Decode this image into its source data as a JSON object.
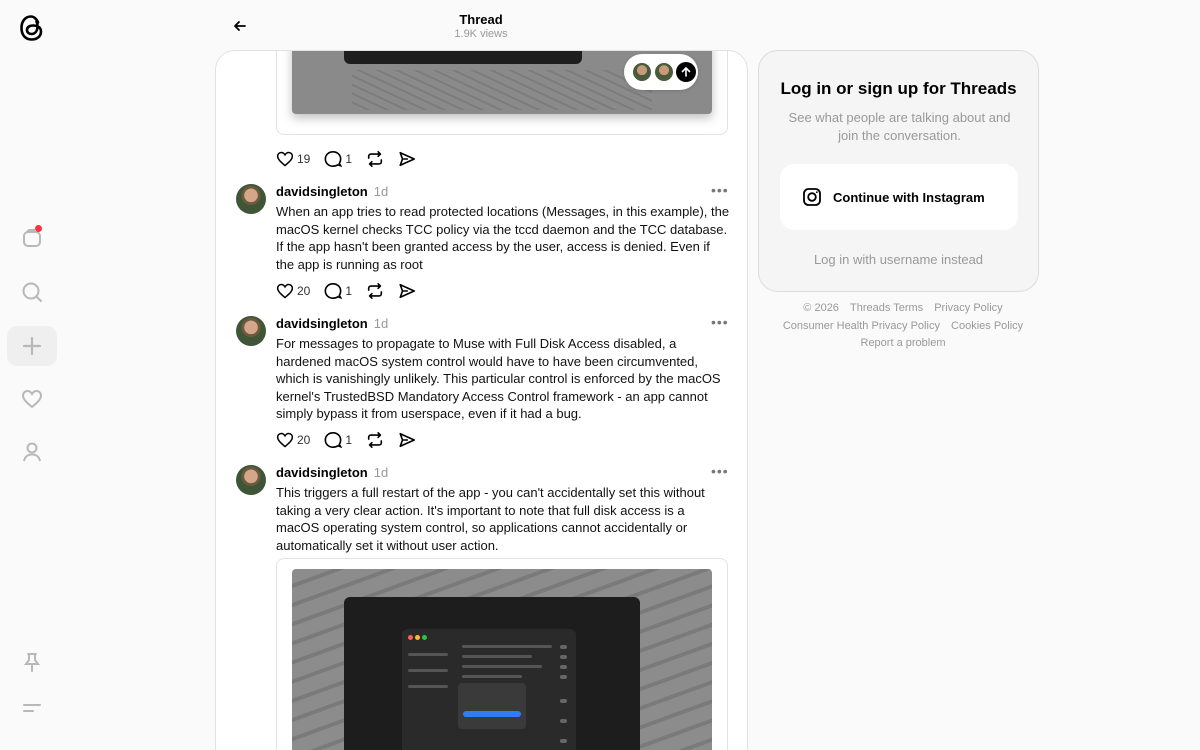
{
  "nav": {
    "logo": "threads-logo-icon",
    "items": [
      "activity-icon",
      "search-icon",
      "create-icon",
      "heart-icon",
      "profile-icon"
    ],
    "bottom": [
      "pin-icon",
      "menu-icon"
    ]
  },
  "header": {
    "title": "Thread",
    "views": "1.9K views"
  },
  "posts": [
    {
      "likes": "19",
      "replies": "1"
    },
    {
      "user": "davidsingleton",
      "time": "1d",
      "text": "When an app tries to read protected locations (Messages, in this example), the macOS kernel checks TCC policy via the tccd daemon and the TCC database. If the app hasn't been granted access by the user, access is denied. Even if the app is running as root",
      "likes": "20",
      "replies": "1"
    },
    {
      "user": "davidsingleton",
      "time": "1d",
      "text": "For messages to propagate to Muse with Full Disk Access disabled, a hardened macOS system control would have to have been circumvented, which is vanishingly unlikely. This particular control is enforced by the macOS kernel's TrustedBSD Mandatory Access Control framework - an app cannot simply bypass it from userspace, even if it had a bug.",
      "likes": "20",
      "replies": "1"
    },
    {
      "user": "davidsingleton",
      "time": "1d",
      "text": "This triggers a full restart of the app - you can't accidentally set this without taking a very clear action. It's important to note that full disk access is a macOS operating system control, so applications cannot accidentally or automatically set it without user action."
    }
  ],
  "login": {
    "title": "Log in or sign up for Threads",
    "subtitle": "See what people are talking about and join the conversation.",
    "instagram_button": "Continue with Instagram",
    "alt_login": "Log in with username instead"
  },
  "footer": {
    "copyright": "© 2026",
    "links": [
      "Threads Terms",
      "Privacy Policy",
      "Consumer Health Privacy Policy",
      "Cookies Policy",
      "Report a problem"
    ]
  },
  "colors": {
    "notification": "#ff3040",
    "text_muted": "#999999"
  }
}
